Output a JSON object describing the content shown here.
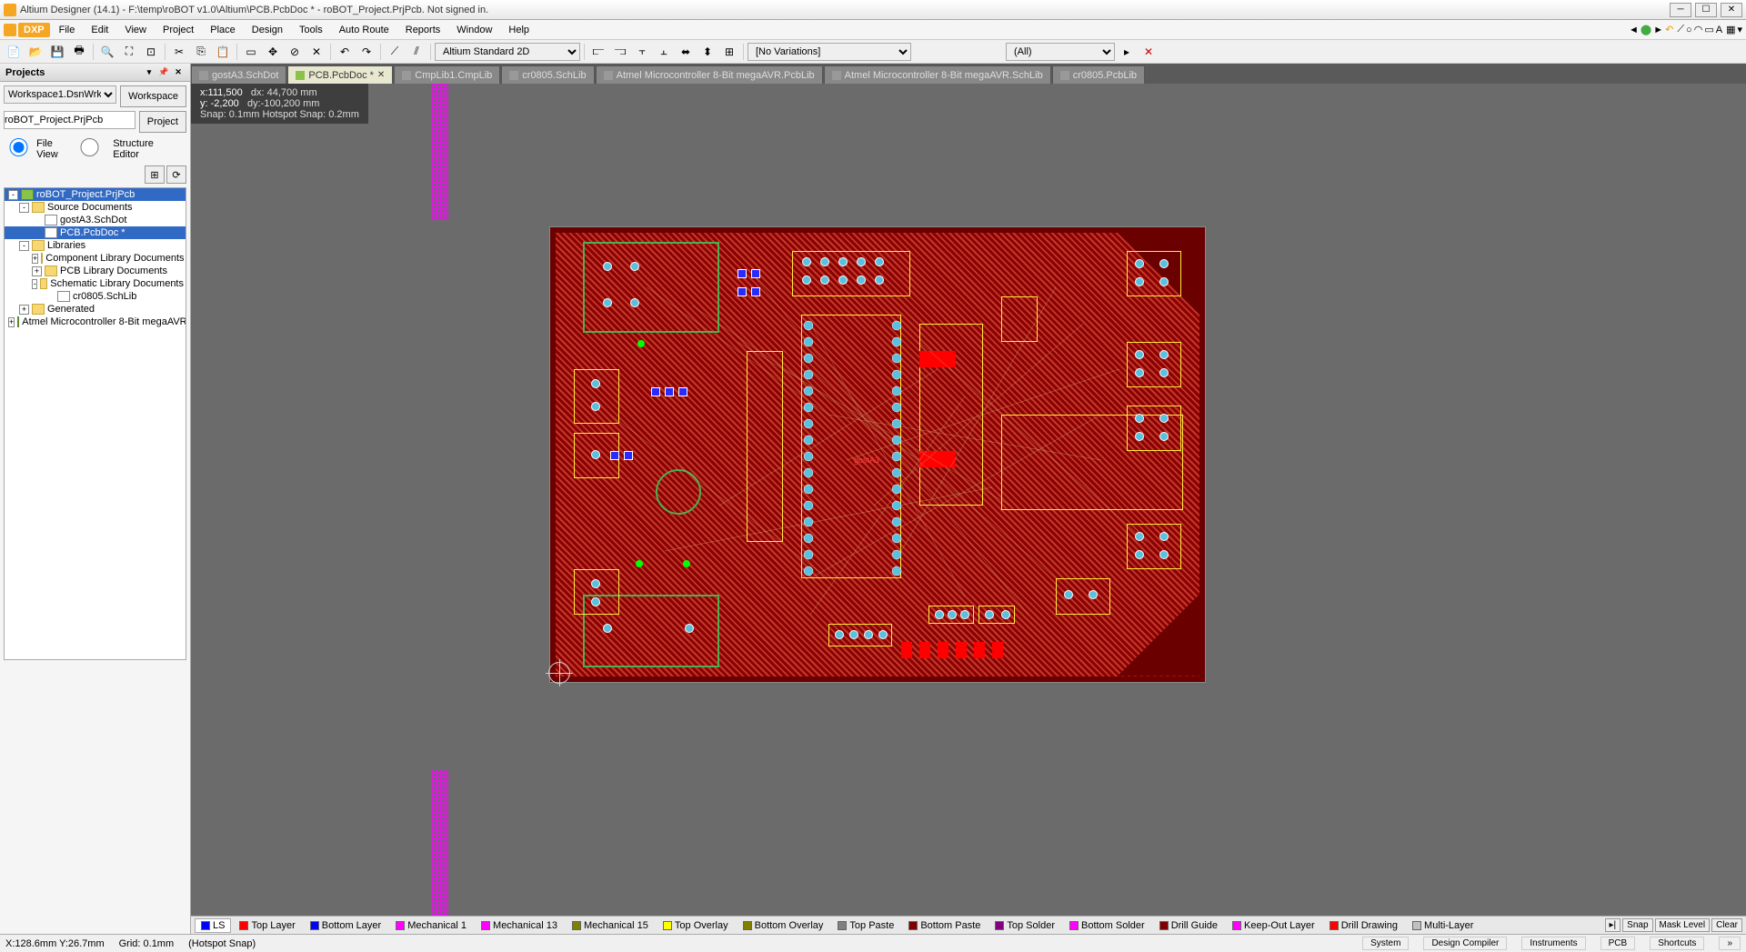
{
  "title": "Altium Designer (14.1) - F:\\temp\\roBOT v1.0\\Altium\\PCB.PcbDoc * - roBOT_Project.PrjPcb. Not signed in.",
  "menus": [
    "DXP",
    "File",
    "Edit",
    "View",
    "Project",
    "Place",
    "Design",
    "Tools",
    "Auto Route",
    "Reports",
    "Window",
    "Help"
  ],
  "toolbar": {
    "viewmode": "Altium Standard 2D",
    "variations": "[No Variations]",
    "filter": "(All)"
  },
  "projects": {
    "title": "Projects",
    "workspace_sel": "Workspace1.DsnWrk",
    "workspace_btn": "Workspace",
    "project_sel": "roBOT_Project.PrjPcb",
    "project_btn": "Project",
    "radio_file": "File View",
    "radio_struct": "Structure Editor",
    "tree": [
      {
        "d": 0,
        "t": "roBOT_Project.PrjPcb",
        "ico": "prj",
        "tog": "-",
        "sel": true
      },
      {
        "d": 1,
        "t": "Source Documents",
        "ico": "folder",
        "tog": "-"
      },
      {
        "d": 2,
        "t": "gostA3.SchDot",
        "ico": "doc",
        "tog": ""
      },
      {
        "d": 2,
        "t": "PCB.PcbDoc *",
        "ico": "doc",
        "tog": "",
        "sel": true
      },
      {
        "d": 1,
        "t": "Libraries",
        "ico": "folder",
        "tog": "-"
      },
      {
        "d": 2,
        "t": "Component Library Documents",
        "ico": "folder",
        "tog": "+"
      },
      {
        "d": 2,
        "t": "PCB Library Documents",
        "ico": "folder",
        "tog": "+"
      },
      {
        "d": 2,
        "t": "Schematic Library Documents",
        "ico": "folder",
        "tog": "-"
      },
      {
        "d": 3,
        "t": "cr0805.SchLib",
        "ico": "doc",
        "tog": ""
      },
      {
        "d": 1,
        "t": "Generated",
        "ico": "folder",
        "tog": "+"
      },
      {
        "d": 0,
        "t": "Atmel Microcontroller 8-Bit megaAVR",
        "ico": "prj",
        "tog": "+"
      }
    ]
  },
  "tabs": [
    {
      "label": "gostA3.SchDot",
      "active": false
    },
    {
      "label": "PCB.PcbDoc *",
      "active": true
    },
    {
      "label": "CmpLib1.CmpLib",
      "active": false
    },
    {
      "label": "cr0805.SchLib",
      "active": false
    },
    {
      "label": "Atmel Microcontroller 8-Bit megaAVR.PcbLib",
      "active": false
    },
    {
      "label": "Atmel Microcontroller 8-Bit megaAVR.SchLib",
      "active": false
    },
    {
      "label": "cr0805.PcbLib",
      "active": false
    }
  ],
  "coords": {
    "x": "x:111,500",
    "dx": "dx: 44,700   mm",
    "y": "y:  -2,200",
    "dy": "dy:-100,200 mm",
    "snap": "Snap: 0.1mm Hotspot Snap: 0.2mm"
  },
  "pcb_label": "gostA3",
  "layers": [
    {
      "name": "LS",
      "color": "#0000ff",
      "active": true
    },
    {
      "name": "Top Layer",
      "color": "#ff0000"
    },
    {
      "name": "Bottom Layer",
      "color": "#0000ff"
    },
    {
      "name": "Mechanical 1",
      "color": "#ff00ff"
    },
    {
      "name": "Mechanical 13",
      "color": "#ff00ff"
    },
    {
      "name": "Mechanical 15",
      "color": "#808000"
    },
    {
      "name": "Top Overlay",
      "color": "#ffff00"
    },
    {
      "name": "Bottom Overlay",
      "color": "#808000"
    },
    {
      "name": "Top Paste",
      "color": "#808080"
    },
    {
      "name": "Bottom Paste",
      "color": "#800000"
    },
    {
      "name": "Top Solder",
      "color": "#800080"
    },
    {
      "name": "Bottom Solder",
      "color": "#ff00ff"
    },
    {
      "name": "Drill Guide",
      "color": "#800000"
    },
    {
      "name": "Keep-Out Layer",
      "color": "#ff00ff"
    },
    {
      "name": "Drill Drawing",
      "color": "#ff0000"
    },
    {
      "name": "Multi-Layer",
      "color": "#c0c0c0"
    }
  ],
  "layer_right": [
    "Snap",
    "Mask Level",
    "Clear"
  ],
  "status": {
    "pos": "X:128.6mm Y:26.7mm",
    "grid": "Grid: 0.1mm",
    "hotspot": "(Hotspot Snap)",
    "right": [
      "System",
      "Design Compiler",
      "Instruments",
      "PCB",
      "Shortcuts"
    ]
  }
}
